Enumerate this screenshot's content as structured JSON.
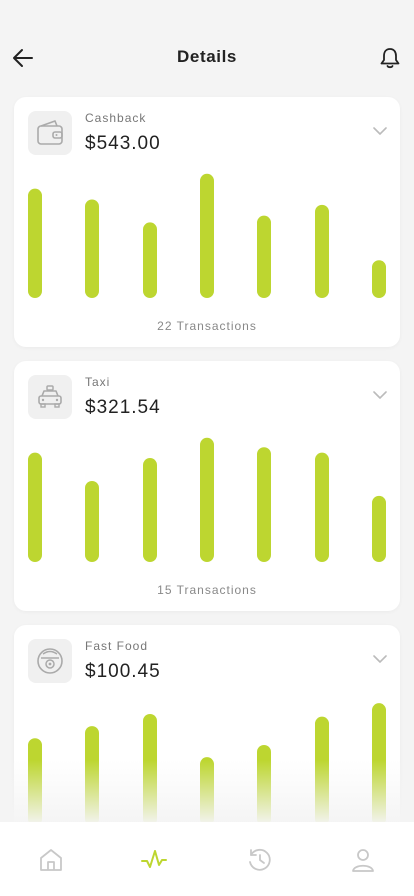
{
  "header": {
    "title": "Details",
    "back_icon": "arrow-left-icon",
    "bell_icon": "bell-icon"
  },
  "accent_color": "#bdd630",
  "cards": [
    {
      "label": "Cashback",
      "amount": "$543.00",
      "icon": "wallet-icon",
      "transactions": "22 Transactions",
      "bar_levels": [
        0.81,
        0.73,
        0.56,
        0.92,
        0.61,
        0.69,
        0.28
      ]
    },
    {
      "label": "Taxi",
      "amount": "$321.54",
      "icon": "taxi-icon",
      "transactions": "15 Transactions",
      "bar_levels": [
        0.81,
        0.6,
        0.77,
        0.92,
        0.85,
        0.81,
        0.49
      ]
    },
    {
      "label": "Fast Food",
      "amount": "$100.45",
      "icon": "food-icon",
      "transactions": "",
      "bar_levels": [
        0.65,
        0.74,
        0.83,
        0.51,
        0.6,
        0.81,
        0.91
      ]
    }
  ],
  "tabbar": {
    "items": [
      {
        "icon": "home-icon",
        "active": false
      },
      {
        "icon": "activity-icon",
        "active": true
      },
      {
        "icon": "history-icon",
        "active": false
      },
      {
        "icon": "profile-icon",
        "active": false
      }
    ]
  }
}
